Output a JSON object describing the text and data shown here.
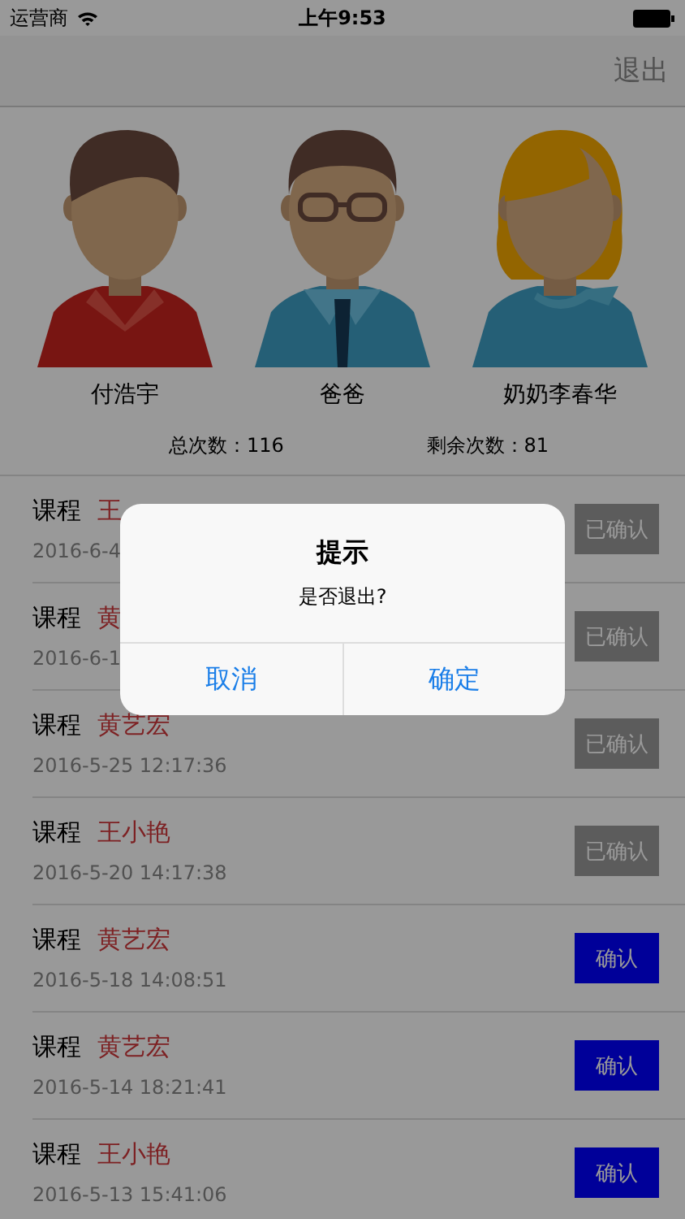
{
  "status_bar": {
    "carrier": "运营商",
    "time": "上午9:53"
  },
  "nav": {
    "logout": "退出"
  },
  "members": [
    {
      "name": "付浩宇",
      "kind": "boy"
    },
    {
      "name": "爸爸",
      "kind": "man"
    },
    {
      "name": "奶奶李春华",
      "kind": "woman"
    }
  ],
  "stats": {
    "total": "总次数：116",
    "remaining": "剩余次数：81"
  },
  "records": [
    {
      "label": "课程",
      "teacher": "王",
      "time": "2016-6-4",
      "button": "已确认",
      "confirmed": true
    },
    {
      "label": "课程",
      "teacher": "黄",
      "time": "2016-6-1",
      "button": "已确认",
      "confirmed": true
    },
    {
      "label": "课程",
      "teacher": "黄艺宏",
      "time": "2016-5-25 12:17:36",
      "button": "已确认",
      "confirmed": true
    },
    {
      "label": "课程",
      "teacher": "王小艳",
      "time": "2016-5-20 14:17:38",
      "button": "已确认",
      "confirmed": true
    },
    {
      "label": "课程",
      "teacher": "黄艺宏",
      "time": "2016-5-18 14:08:51",
      "button": "确认",
      "confirmed": false
    },
    {
      "label": "课程",
      "teacher": "黄艺宏",
      "time": "2016-5-14 18:21:41",
      "button": "确认",
      "confirmed": false
    },
    {
      "label": "课程",
      "teacher": "王小艳",
      "time": "2016-5-13 15:41:06",
      "button": "确认",
      "confirmed": false
    }
  ],
  "alert": {
    "title": "提示",
    "message": "是否退出?",
    "buttons": [
      "取消",
      "确定"
    ]
  }
}
